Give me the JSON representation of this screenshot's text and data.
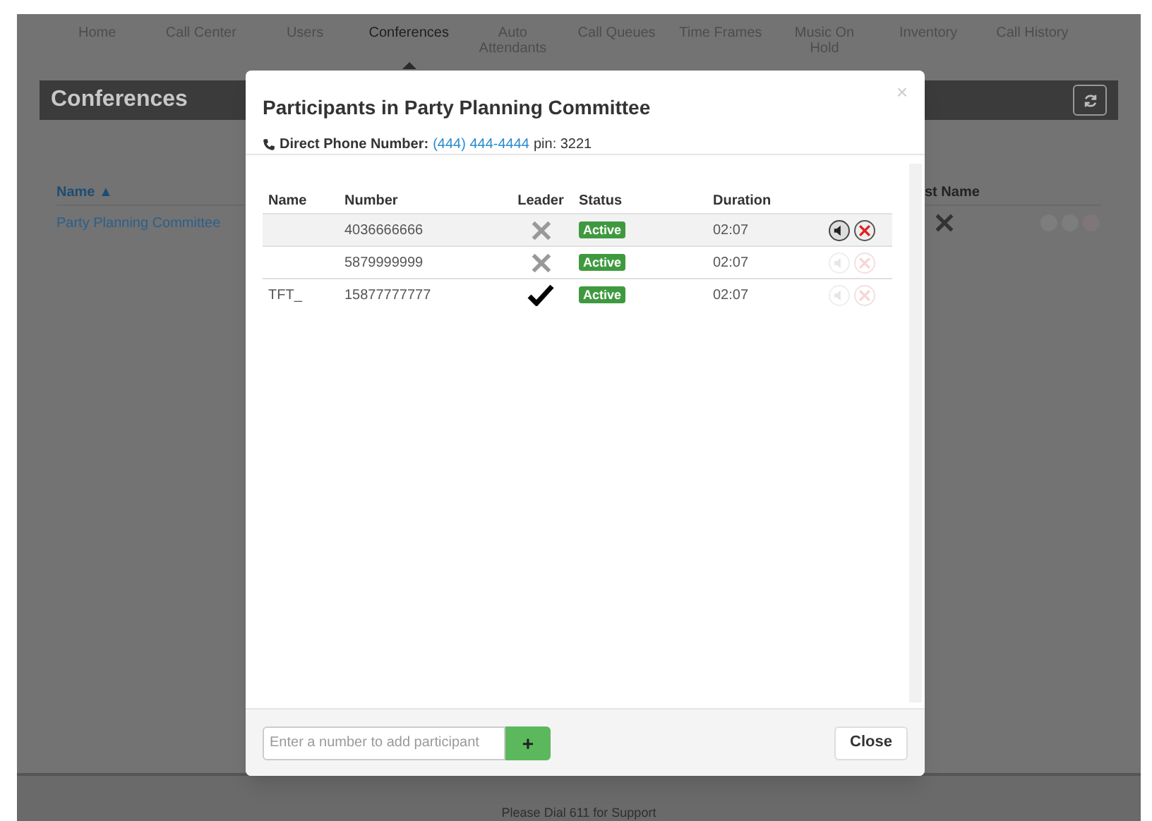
{
  "nav": [
    {
      "label": "Home",
      "selected": false
    },
    {
      "label": "Call Center",
      "selected": false
    },
    {
      "label": "Users",
      "selected": false
    },
    {
      "label": "Conferences",
      "selected": true
    },
    {
      "label": "Auto Attendants",
      "selected": false
    },
    {
      "label": "Call Queues",
      "selected": false
    },
    {
      "label": "Time Frames",
      "selected": false
    },
    {
      "label": "Music On Hold",
      "selected": false
    },
    {
      "label": "Inventory",
      "selected": false
    },
    {
      "label": "Call History",
      "selected": false
    }
  ],
  "page": {
    "title": "Conferences",
    "table": {
      "columns": [
        "Name ▲",
        "st Name"
      ],
      "rows": [
        {
          "name": "Party Planning Committee"
        }
      ]
    }
  },
  "modal": {
    "title": "Participants in Party Planning Committee",
    "phone_label": "Direct Phone Number:",
    "phone_number": "(444) 444-4444",
    "pin": "pin: 3221",
    "close_x": "×",
    "columns": [
      "Name",
      "Number",
      "Leader",
      "Status",
      "Duration"
    ],
    "rows": [
      {
        "name": "",
        "number": "4036666666",
        "leader": false,
        "status": "Active",
        "duration": "02:07",
        "selected": true,
        "actions_enabled": true
      },
      {
        "name": "",
        "number": "5879999999",
        "leader": false,
        "status": "Active",
        "duration": "02:07",
        "selected": false,
        "actions_enabled": false
      },
      {
        "name": "TFT_",
        "number": "15877777777",
        "leader": true,
        "status": "Active",
        "duration": "02:07",
        "selected": false,
        "actions_enabled": false
      }
    ],
    "add_field": {
      "placeholder": "Enter a number to add participant"
    },
    "add_button": "+",
    "close_button": "Close"
  },
  "footer": "Please Dial 611 for Support"
}
